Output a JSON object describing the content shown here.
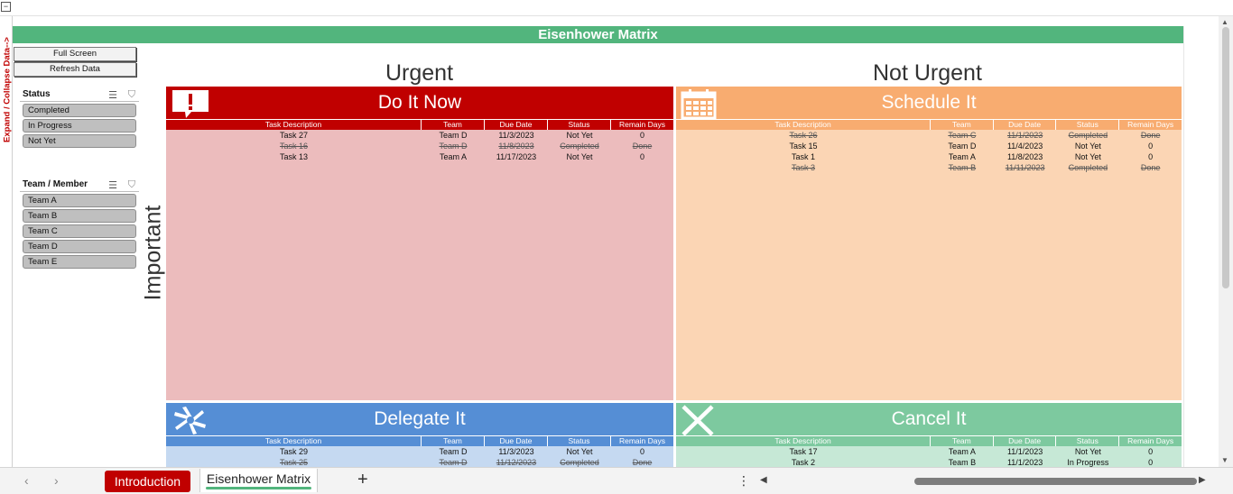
{
  "expand_label": "Expand / Collapse Data-->",
  "title": "Eisenhower Matrix",
  "buttons": {
    "full_screen": "Full Screen",
    "refresh": "Refresh Data"
  },
  "slicers": {
    "status": {
      "title": "Status",
      "items": [
        "Completed",
        "In Progress",
        "Not Yet"
      ]
    },
    "team": {
      "title": "Team / Member",
      "items": [
        "Team A",
        "Team B",
        "Team C",
        "Team D",
        "Team E"
      ]
    }
  },
  "axes": {
    "urgent": "Urgent",
    "not_urgent": "Not Urgent",
    "important": "Important"
  },
  "columns": [
    "Task Description",
    "Team",
    "Due Date",
    "Status",
    "Remain Days"
  ],
  "quadrants": {
    "do": {
      "title": "Do It Now",
      "head_color": "#c00000",
      "body_color": "#ecbcbd",
      "icon": "alert-bubble-icon",
      "rows": [
        [
          "Task 27",
          "Team D",
          "11/3/2023",
          "Not Yet",
          "0"
        ],
        [
          "Task 16",
          "Team D",
          "11/8/2023",
          "Completed",
          "Done"
        ],
        [
          "Task 13",
          "Team A",
          "11/17/2023",
          "Not Yet",
          "0"
        ]
      ]
    },
    "schedule": {
      "title": "Schedule It",
      "head_color": "#f8ac70",
      "body_color": "#fbd5b4",
      "icon": "calendar-icon",
      "rows": [
        [
          "Task 26",
          "Team C",
          "11/1/2023",
          "Completed",
          "Done"
        ],
        [
          "Task 15",
          "Team D",
          "11/4/2023",
          "Not Yet",
          "0"
        ],
        [
          "Task 1",
          "Team A",
          "11/8/2023",
          "Not Yet",
          "0"
        ],
        [
          "Task 3",
          "Team B",
          "11/11/2023",
          "Completed",
          "Done"
        ]
      ]
    },
    "delegate": {
      "title": "Delegate It",
      "head_color": "#558ed5",
      "body_color": "#c5d9f1",
      "icon": "hands-team-icon",
      "rows": [
        [
          "Task 29",
          "Team D",
          "11/3/2023",
          "Not Yet",
          "0"
        ],
        [
          "Task 25",
          "Team D",
          "11/12/2023",
          "Completed",
          "Done"
        ]
      ]
    },
    "cancel": {
      "title": "Cancel It",
      "head_color": "#7dc99f",
      "body_color": "#c6e8d6",
      "icon": "x-cross-icon",
      "rows": [
        [
          "Task 17",
          "Team A",
          "11/1/2023",
          "Not Yet",
          "0"
        ],
        [
          "Task 2",
          "Team B",
          "11/1/2023",
          "In Progress",
          "0"
        ]
      ]
    }
  },
  "tabs": {
    "intro": "Introduction",
    "active": "Eisenhower Matrix",
    "add": "+"
  }
}
